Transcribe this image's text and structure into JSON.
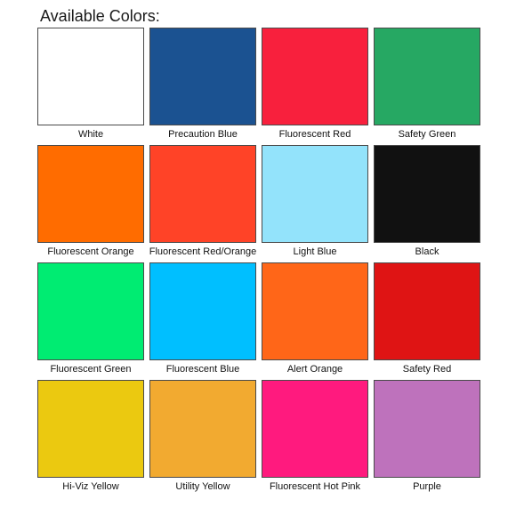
{
  "title": "Available Colors:",
  "colors": [
    {
      "name": "White",
      "hex": "#ffffff"
    },
    {
      "name": "Precaution Blue",
      "hex": "#1b5291"
    },
    {
      "name": "Fluorescent Red",
      "hex": "#f8203d"
    },
    {
      "name": "Safety Green",
      "hex": "#26a863"
    },
    {
      "name": "Fluorescent Orange",
      "hex": "#ff6c00"
    },
    {
      "name": "Fluorescent Red/Orange",
      "hex": "#ff4327"
    },
    {
      "name": "Light Blue",
      "hex": "#93e3fb"
    },
    {
      "name": "Black",
      "hex": "#111111"
    },
    {
      "name": "Fluorescent Green",
      "hex": "#00ec72"
    },
    {
      "name": "Fluorescent Blue",
      "hex": "#00bfff"
    },
    {
      "name": "Alert Orange",
      "hex": "#ff6618"
    },
    {
      "name": "Safety Red",
      "hex": "#df1414"
    },
    {
      "name": "Hi-Viz Yellow",
      "hex": "#ebc910"
    },
    {
      "name": "Utility Yellow",
      "hex": "#f2aa30"
    },
    {
      "name": "Fluorescent Hot Pink",
      "hex": "#ff1a7e"
    },
    {
      "name": "Purple",
      "hex": "#be72bc"
    }
  ]
}
